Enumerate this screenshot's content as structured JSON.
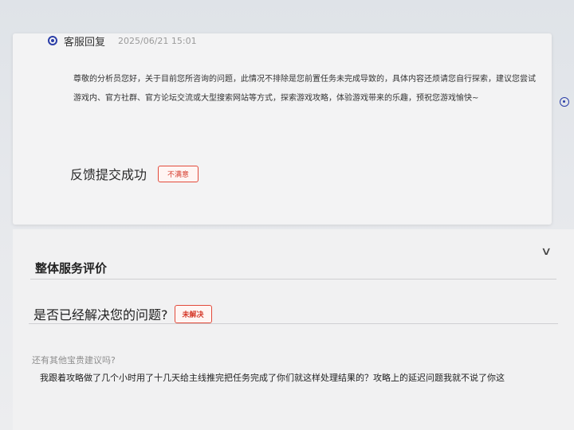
{
  "reply": {
    "author": "客服回复",
    "time": "2025/06/21 15:01",
    "body": "尊敬的分析员您好，关于目前您所咨询的问题，此情况不排除是您前置任务未完成导致的，具体内容还烦请您自行探索，建议您尝试游戏内、官方社群、官方论坛交流或大型搜索网站等方式，探索游戏攻略，体验游戏带来的乐趣，预祝您游戏愉快~",
    "feedback_status": "反馈提交成功",
    "rating_tag": "不满意"
  },
  "evaluation": {
    "title": "整体服务评价",
    "question": "是否已经解决您的问题?",
    "answer_tag": "未解决",
    "suggestion_label": "还有其他宝贵建议吗?",
    "suggestion_text": "我跟着攻略做了几个小时用了十几天给主线推完把任务完成了你们就这样处理结果的？攻略上的延迟问题我就不说了你这"
  },
  "colors": {
    "accent": "#2b3ea8",
    "tag_red": "#d63a2b"
  },
  "icons": {
    "collapse": "chevron-down-icon",
    "reply_marker": "radio-dot-icon"
  }
}
